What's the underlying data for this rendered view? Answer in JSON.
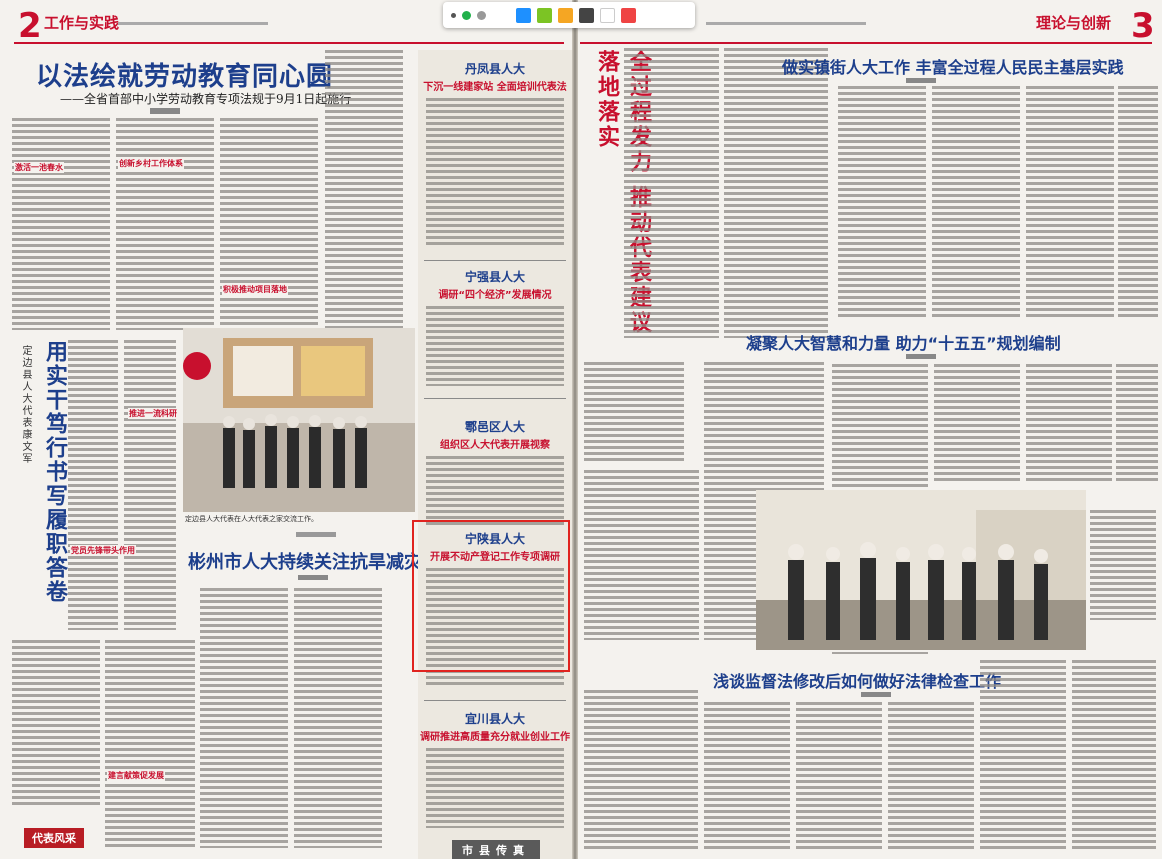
{
  "toolbar": {
    "colors": [
      "#22b14c",
      "#1e90ff",
      "#7cc424",
      "#f5a623",
      "#444444",
      "#ffffff",
      "#ef4444"
    ]
  },
  "left_page": {
    "page_number": "2",
    "section": "工作与实践",
    "lead_headline": "以法绘就劳动教育同心圆",
    "lead_subheadline": "——全省首部中小学劳动教育专项法规于9月1日起施行",
    "vertical_headline": "用实干笃行书写履职答卷",
    "vertical_subtitle": "定边县人大代表康文军",
    "bottom_headline": "彬州市人大持续关注抗旱减灾工作",
    "col_subheads": [
      "激活一池春水",
      "推进一流科研",
      "创新乡村工作体系",
      "党员先锋带头作用",
      "建言献策促发展",
      "积极推动项目落地"
    ],
    "corner_tag": "代表风采",
    "photo_caption": "定边县人大代表在人大代表之家交流工作。"
  },
  "right_page": {
    "page_number": "3",
    "section": "理论与创新",
    "vertical_headline": "全过程发力 推动代表建议落地落实",
    "top_headline": "做实镇街人大工作 丰富全过程人民民主基层实践",
    "mid_headline": "凝聚人大智慧和力量 助力“十五五”规划编制",
    "bottom_headline": "浅谈监督法修改后如何做好法律检查工作",
    "county_column": [
      {
        "title": "丹凤县人大",
        "subtitle": "下沉一线建家站 全面培训代表法"
      },
      {
        "title": "宁强县人大",
        "subtitle": "调研“四个经济”发展情况"
      },
      {
        "title": "鄠邑区人大",
        "subtitle": "组织区人大代表开展视察"
      },
      {
        "title": "宁陕县人大",
        "subtitle": "开展不动产登记工作专项调研"
      },
      {
        "title": "宜川县人大",
        "subtitle": "调研推进高质量充分就业创业工作"
      }
    ],
    "bottom_tag": "市县传真"
  }
}
